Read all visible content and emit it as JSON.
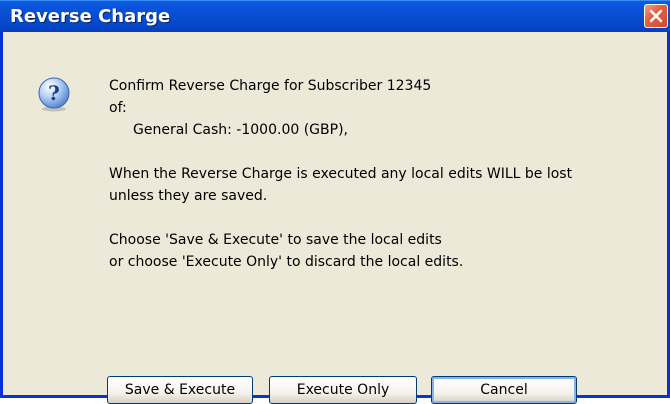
{
  "window": {
    "title": "Reverse Charge",
    "close_icon": "close-icon"
  },
  "dialog": {
    "icon": "question-icon",
    "lines": [
      "Confirm Reverse Charge for Subscriber 12345",
      "of:",
      "General Cash: -1000.00 (GBP),",
      "When the Reverse Charge is executed any local edits WILL be lost",
      "unless they are saved.",
      "Choose 'Save & Execute' to save the local edits",
      "or choose 'Execute Only' to discard the local edits."
    ]
  },
  "buttons": {
    "save_execute": "Save & Execute",
    "execute_only": "Execute Only",
    "cancel": "Cancel"
  },
  "colors": {
    "titlebar": "#0a4fd3",
    "frame": "#0831d9",
    "dialog_bg": "#ece9d8",
    "close_button": "#e5603f"
  }
}
